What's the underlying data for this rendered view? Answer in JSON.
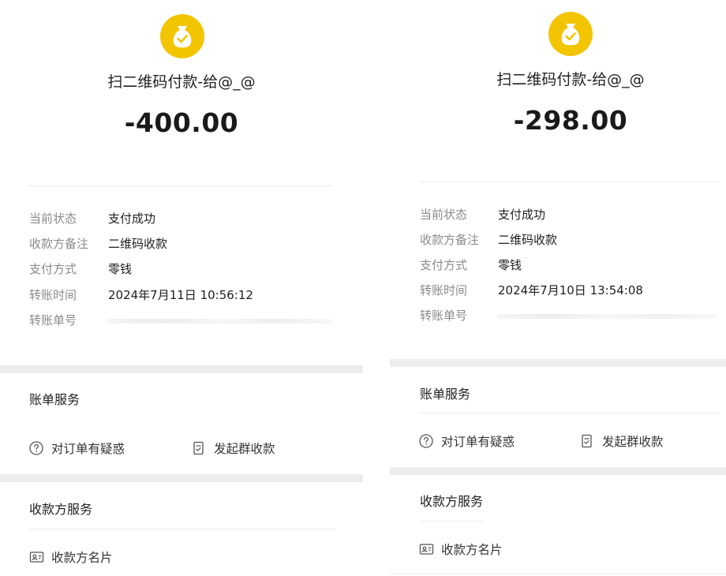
{
  "colors": {
    "accent_yellow": "#f3c400",
    "label_gray": "#8a8a8a",
    "divider": "#ececec",
    "section_gap": "#ededed"
  },
  "receipts": [
    {
      "icon": "money-bag-check-icon",
      "title": "扫二维码付款-给@_@",
      "amount": "-400.00",
      "details": [
        {
          "label": "当前状态",
          "value": "支付成功"
        },
        {
          "label": "收款方备注",
          "value": "二维码收款"
        },
        {
          "label": "支付方式",
          "value": "零钱"
        },
        {
          "label": "转账时间",
          "value": "2024年7月11日 10:56:12"
        },
        {
          "label": "转账单号",
          "value": ""
        }
      ],
      "bill_service": {
        "title": "账单服务",
        "actions": [
          {
            "icon": "question-circle-icon",
            "label": "对订单有疑惑"
          },
          {
            "icon": "receipt-icon",
            "label": "发起群收款"
          }
        ]
      },
      "payee_service": {
        "title": "收款方服务",
        "actions": [
          {
            "icon": "contact-card-icon",
            "label": "收款方名片"
          }
        ]
      }
    },
    {
      "icon": "money-bag-check-icon",
      "title": "扫二维码付款-给@_@",
      "amount": "-298.00",
      "details": [
        {
          "label": "当前状态",
          "value": "支付成功"
        },
        {
          "label": "收款方备注",
          "value": "二维码收款"
        },
        {
          "label": "支付方式",
          "value": "零钱"
        },
        {
          "label": "转账时间",
          "value": "2024年7月10日 13:54:08"
        },
        {
          "label": "转账单号",
          "value": ""
        }
      ],
      "bill_service": {
        "title": "账单服务",
        "actions": [
          {
            "icon": "question-circle-icon",
            "label": "对订单有疑惑"
          },
          {
            "icon": "receipt-icon",
            "label": "发起群收款"
          }
        ]
      },
      "payee_service": {
        "title": "收款方服务",
        "actions": [
          {
            "icon": "contact-card-icon",
            "label": "收款方名片"
          }
        ]
      }
    }
  ]
}
